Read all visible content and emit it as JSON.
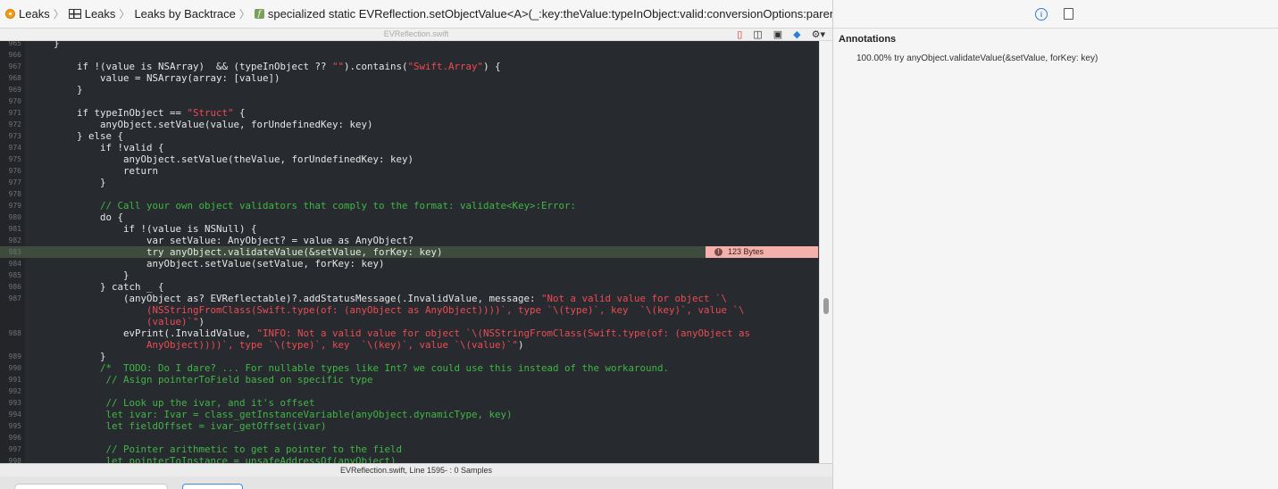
{
  "breadcrumb": {
    "items": [
      "Leaks",
      "Leaks",
      "Leaks by Backtrace",
      "specialized static EVReflection.setObjectValue<A>(_:key:theValue:typeInObject:valid:conversionOptions:parents:)"
    ]
  },
  "editor": {
    "file_title": "EVReflection.swift",
    "lines": [
      {
        "n": "965",
        "t": "    }"
      },
      {
        "n": "966",
        "t": ""
      },
      {
        "n": "967",
        "segs": [
          [
            "",
            "        if !(value is NSArray)  && (typeInObject ?? "
          ],
          [
            "str",
            "\"\""
          ],
          [
            "",
            ").contains("
          ],
          [
            "str",
            "\"Swift.Array\""
          ],
          [
            "",
            ") {"
          ]
        ]
      },
      {
        "n": "968",
        "t": "            value = NSArray(array: [value])"
      },
      {
        "n": "969",
        "t": "        }"
      },
      {
        "n": "970",
        "t": ""
      },
      {
        "n": "971",
        "segs": [
          [
            "",
            "        if typeInObject == "
          ],
          [
            "str",
            "\"Struct\""
          ],
          [
            "",
            " {"
          ]
        ]
      },
      {
        "n": "972",
        "t": "            anyObject.setValue(value, forUndefinedKey: key)"
      },
      {
        "n": "973",
        "t": "        } else {"
      },
      {
        "n": "974",
        "t": "            if !valid {"
      },
      {
        "n": "975",
        "t": "                anyObject.setValue(theValue, forUndefinedKey: key)"
      },
      {
        "n": "976",
        "t": "                return"
      },
      {
        "n": "977",
        "t": "            }"
      },
      {
        "n": "978",
        "t": ""
      },
      {
        "n": "979",
        "segs": [
          [
            "cm",
            "            // Call your own object validators that comply to the format: validate<Key>:Error:"
          ]
        ]
      },
      {
        "n": "980",
        "t": "            do {"
      },
      {
        "n": "981",
        "t": "                if !(value is NSNull) {"
      },
      {
        "n": "982",
        "t": "                    var setValue: AnyObject? = value as AnyObject?"
      },
      {
        "n": "983",
        "t": "                    try anyObject.validateValue(&setValue, forKey: key)",
        "hl": true
      },
      {
        "n": "984",
        "t": "                    anyObject.setValue(setValue, forKey: key)"
      },
      {
        "n": "985",
        "t": "                }"
      },
      {
        "n": "986",
        "t": "            } catch _ {"
      },
      {
        "n": "987",
        "segs": [
          [
            "",
            "                (anyObject as? EVReflectable)?.addStatusMessage(.InvalidValue, message: "
          ],
          [
            "str",
            "\"Not a valid value for object `\\"
          ]
        ]
      },
      {
        "n": "",
        "segs": [
          [
            "str",
            "                    (NSStringFromClass(Swift.type(of: (anyObject as AnyObject))))`, type `\\(type)`, key  `\\(key)`, value `\\"
          ]
        ]
      },
      {
        "n": "",
        "segs": [
          [
            "str",
            "                    (value)`\""
          ],
          [
            "",
            ")"
          ]
        ]
      },
      {
        "n": "988",
        "segs": [
          [
            "",
            "                evPrint(.InvalidValue, "
          ],
          [
            "str",
            "\"INFO: Not a valid value for object `\\(NSStringFromClass(Swift.type(of: (anyObject as"
          ]
        ]
      },
      {
        "n": "",
        "segs": [
          [
            "str",
            "                    AnyObject))))`, type `\\(type)`, key  `\\(key)`, value `\\(value)`\""
          ],
          [
            "",
            ")"
          ]
        ]
      },
      {
        "n": "989",
        "t": "            }"
      },
      {
        "n": "990",
        "segs": [
          [
            "cm",
            "            /*  TODO: Do I dare? ... For nullable types like Int? we could use this instead of the workaround."
          ]
        ]
      },
      {
        "n": "991",
        "segs": [
          [
            "cm",
            "             // Asign pointerToField based on specific type"
          ]
        ]
      },
      {
        "n": "992",
        "t": ""
      },
      {
        "n": "993",
        "segs": [
          [
            "cm",
            "             // Look up the ivar, and it's offset"
          ]
        ]
      },
      {
        "n": "994",
        "segs": [
          [
            "cm",
            "             let ivar: Ivar = class_getInstanceVariable(anyObject.dynamicType, key)"
          ]
        ]
      },
      {
        "n": "995",
        "segs": [
          [
            "cm",
            "             let fieldOffset = ivar_getOffset(ivar)"
          ]
        ]
      },
      {
        "n": "996",
        "t": ""
      },
      {
        "n": "997",
        "segs": [
          [
            "cm",
            "             // Pointer arithmetic to get a pointer to the field"
          ]
        ]
      },
      {
        "n": "998",
        "segs": [
          [
            "cm",
            "             let pointerToInstance = unsafeAddressOf(anyObject)"
          ]
        ]
      }
    ],
    "leak_badge": "123 Bytes",
    "leak_badge_line": "983"
  },
  "status_bar": {
    "text": "EVReflection.swift, Line 1595- : 0 Samples"
  },
  "inspector": {
    "title": "Annotations",
    "row": "100.00% try anyObject.validateValue(&setValue, forKey: key)"
  },
  "icons": {
    "leaks": "leaks-instrument-icon",
    "grid": "backtrace-table-icon",
    "function": "function-icon",
    "info": "info-icon",
    "document": "document-icon"
  }
}
